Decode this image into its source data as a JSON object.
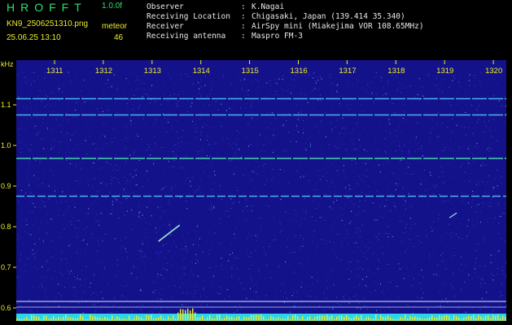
{
  "app": {
    "title": "HROFFT",
    "version": "1.0.0f"
  },
  "file": {
    "name": "KN9_2506251310.png",
    "date_time": "25.06.25 13:10"
  },
  "meteor": {
    "label": "meteor",
    "count": "46"
  },
  "info": [
    {
      "key": "Observer",
      "value": "K.Nagai"
    },
    {
      "key": "Receiving Location",
      "value": "Chigasaki, Japan (139.414 35.340)"
    },
    {
      "key": "Receiver",
      "value": "AirSpy mini (Miakejima VOR 108.65MHz)"
    },
    {
      "key": "Receiving antenna",
      "value": "Maspro FM-3"
    }
  ],
  "chart_data": {
    "type": "heatmap",
    "ylabel": "kHz",
    "y_ticks": [
      "1.1",
      "1.0",
      "0.9",
      "0.8",
      "0.7",
      "0.6"
    ],
    "x_ticks": [
      "1311",
      "1312",
      "1313",
      "1314",
      "1315",
      "1316",
      "1317",
      "1318",
      "1319",
      "1320"
    ],
    "carrier_lines_khz": [
      1.115,
      1.075,
      0.968,
      0.875
    ],
    "meteor_echoes": [
      {
        "time": 1313.6,
        "khz": 0.8
      },
      {
        "time": 1319.2,
        "khz": 0.83
      }
    ],
    "colors": {
      "background": "#14128a",
      "signal": "#3fe0d8",
      "text": "#ecec2a"
    }
  }
}
